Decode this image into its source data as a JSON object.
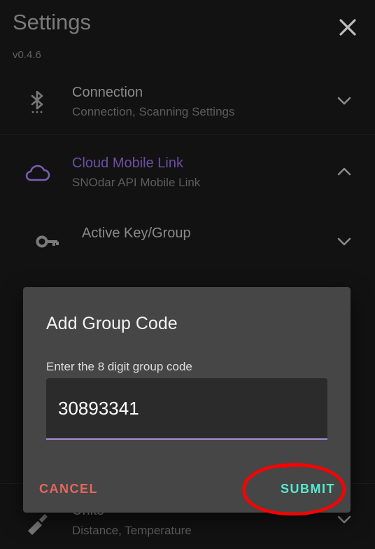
{
  "header": {
    "title": "Settings",
    "version": "v0.4.6"
  },
  "sections": [
    {
      "title": "Connection",
      "subtitle": "Connection, Scanning Settings",
      "icon": "bluetooth-icon"
    },
    {
      "title": "Cloud Mobile Link",
      "subtitle": "SNOdar API Mobile Link",
      "icon": "cloud-icon"
    },
    {
      "title": "Active Key/Group",
      "subtitle": "",
      "icon": "key-icon"
    },
    {
      "title": "Units",
      "subtitle": "Distance, Temperature",
      "icon": "ruler-pencil-icon"
    }
  ],
  "dialog": {
    "title": "Add Group Code",
    "label": "Enter the 8 digit group code",
    "input_value": "30893341",
    "cancel_label": "CANCEL",
    "submit_label": "SUBMIT"
  },
  "colors": {
    "accent_purple": "#8e6bc4",
    "cancel_red": "#e2675f",
    "submit_teal": "#57e8cf",
    "annotation_red": "#ff0000"
  }
}
